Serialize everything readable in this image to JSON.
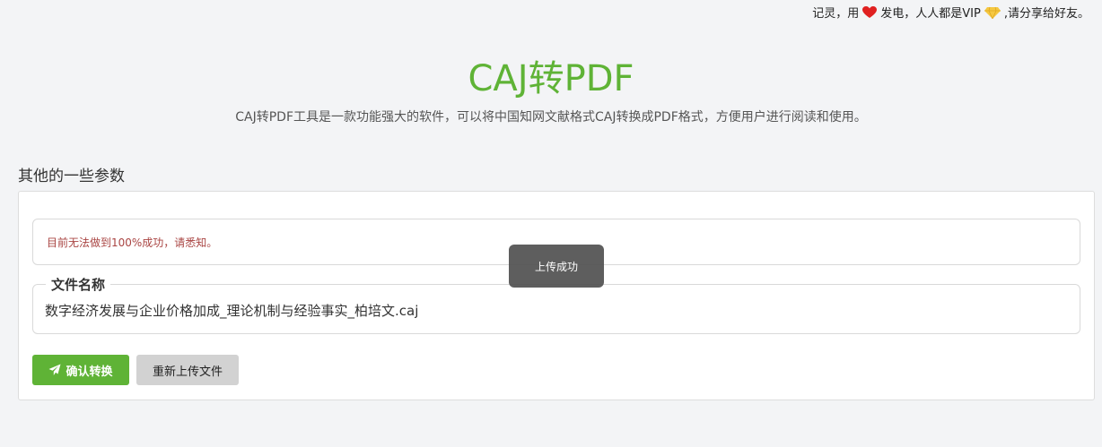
{
  "topbar": {
    "prefix": "记灵，用",
    "middle": "发电，人人都是VIP",
    "suffix": ",请分享给好友。",
    "icons": [
      "heart-icon",
      "diamond-icon"
    ],
    "heart_color": "#e02020",
    "diamond_color": "#f5c842"
  },
  "hero": {
    "title": "CAJ转PDF",
    "description": "CAJ转PDF工具是一款功能强大的软件，可以将中国知网文献格式CAJ转换成PDF格式，方便用户进行阅读和使用。"
  },
  "params": {
    "section_title": "其他的一些参数",
    "notice": "目前无法做到100%成功，请悉知。",
    "file_legend": "文件名称",
    "file_name": "数字经济发展与企业价格加成_理论机制与经验事实_柏培文.caj"
  },
  "actions": {
    "confirm_label": "确认转换",
    "confirm_icon": "send-icon",
    "reupload_label": "重新上传文件"
  },
  "toast": {
    "message": "上传成功"
  },
  "colors": {
    "accent": "#5fb336",
    "notice_text": "#a94442",
    "background": "#f3f4f6"
  }
}
